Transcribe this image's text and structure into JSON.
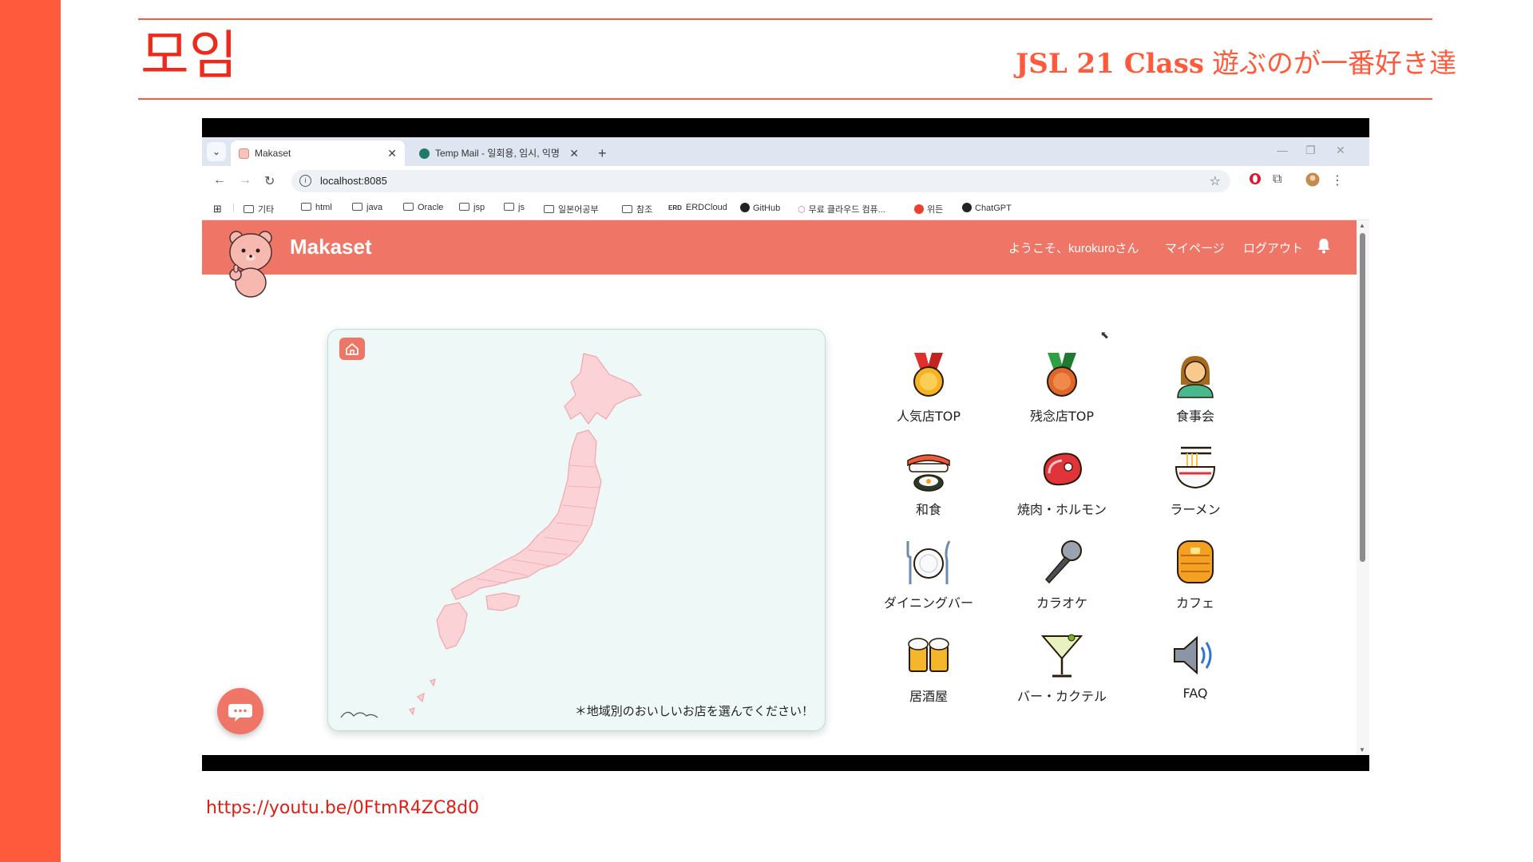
{
  "slide": {
    "title": "모임",
    "subtitle_class": "JSL 21 Class",
    "subtitle_team": "遊ぶのが一番好き達",
    "video_link": "https://youtu.be/0FtmR4ZC8d0",
    "accent_color": "#ff5a3c"
  },
  "browser": {
    "tabs": [
      {
        "label": "Makaset",
        "active": true
      },
      {
        "label": "Temp Mail - 일회용, 임시, 익명",
        "active": false
      }
    ],
    "url": "localhost:8085",
    "bookmarks": [
      "기타",
      "html",
      "java",
      "Oracle",
      "jsp",
      "js",
      "일본어공부",
      "참조",
      "ERDCloud",
      "GitHub",
      "무료 클라우드 컴퓨...",
      "위든",
      "ChatGPT"
    ]
  },
  "app": {
    "brand": "Makaset",
    "header_color": "#ef7566",
    "nav": {
      "welcome": "ようこそ、kurokuroさん",
      "mypage": "マイページ",
      "logout": "ログアウト"
    },
    "map_note": "＊地域別のおいしいお店を選んでください！",
    "categories": [
      {
        "label": "人気店TOP",
        "icon": "gold-medal-icon"
      },
      {
        "label": "残念店TOP",
        "icon": "bronze-medal-icon"
      },
      {
        "label": "食事会",
        "icon": "person-icon"
      },
      {
        "label": "和食",
        "icon": "sushi-icon"
      },
      {
        "label": "焼肉・ホルモン",
        "icon": "meat-icon"
      },
      {
        "label": "ラーメン",
        "icon": "ramen-icon"
      },
      {
        "label": "ダイニングバー",
        "icon": "plate-cutlery-icon"
      },
      {
        "label": "カラオケ",
        "icon": "microphone-icon"
      },
      {
        "label": "カフェ",
        "icon": "pancake-icon"
      },
      {
        "label": "居酒屋",
        "icon": "beer-mugs-icon"
      },
      {
        "label": "バー・カクテル",
        "icon": "cocktail-icon"
      },
      {
        "label": "FAQ",
        "icon": "speaker-icon"
      }
    ]
  }
}
